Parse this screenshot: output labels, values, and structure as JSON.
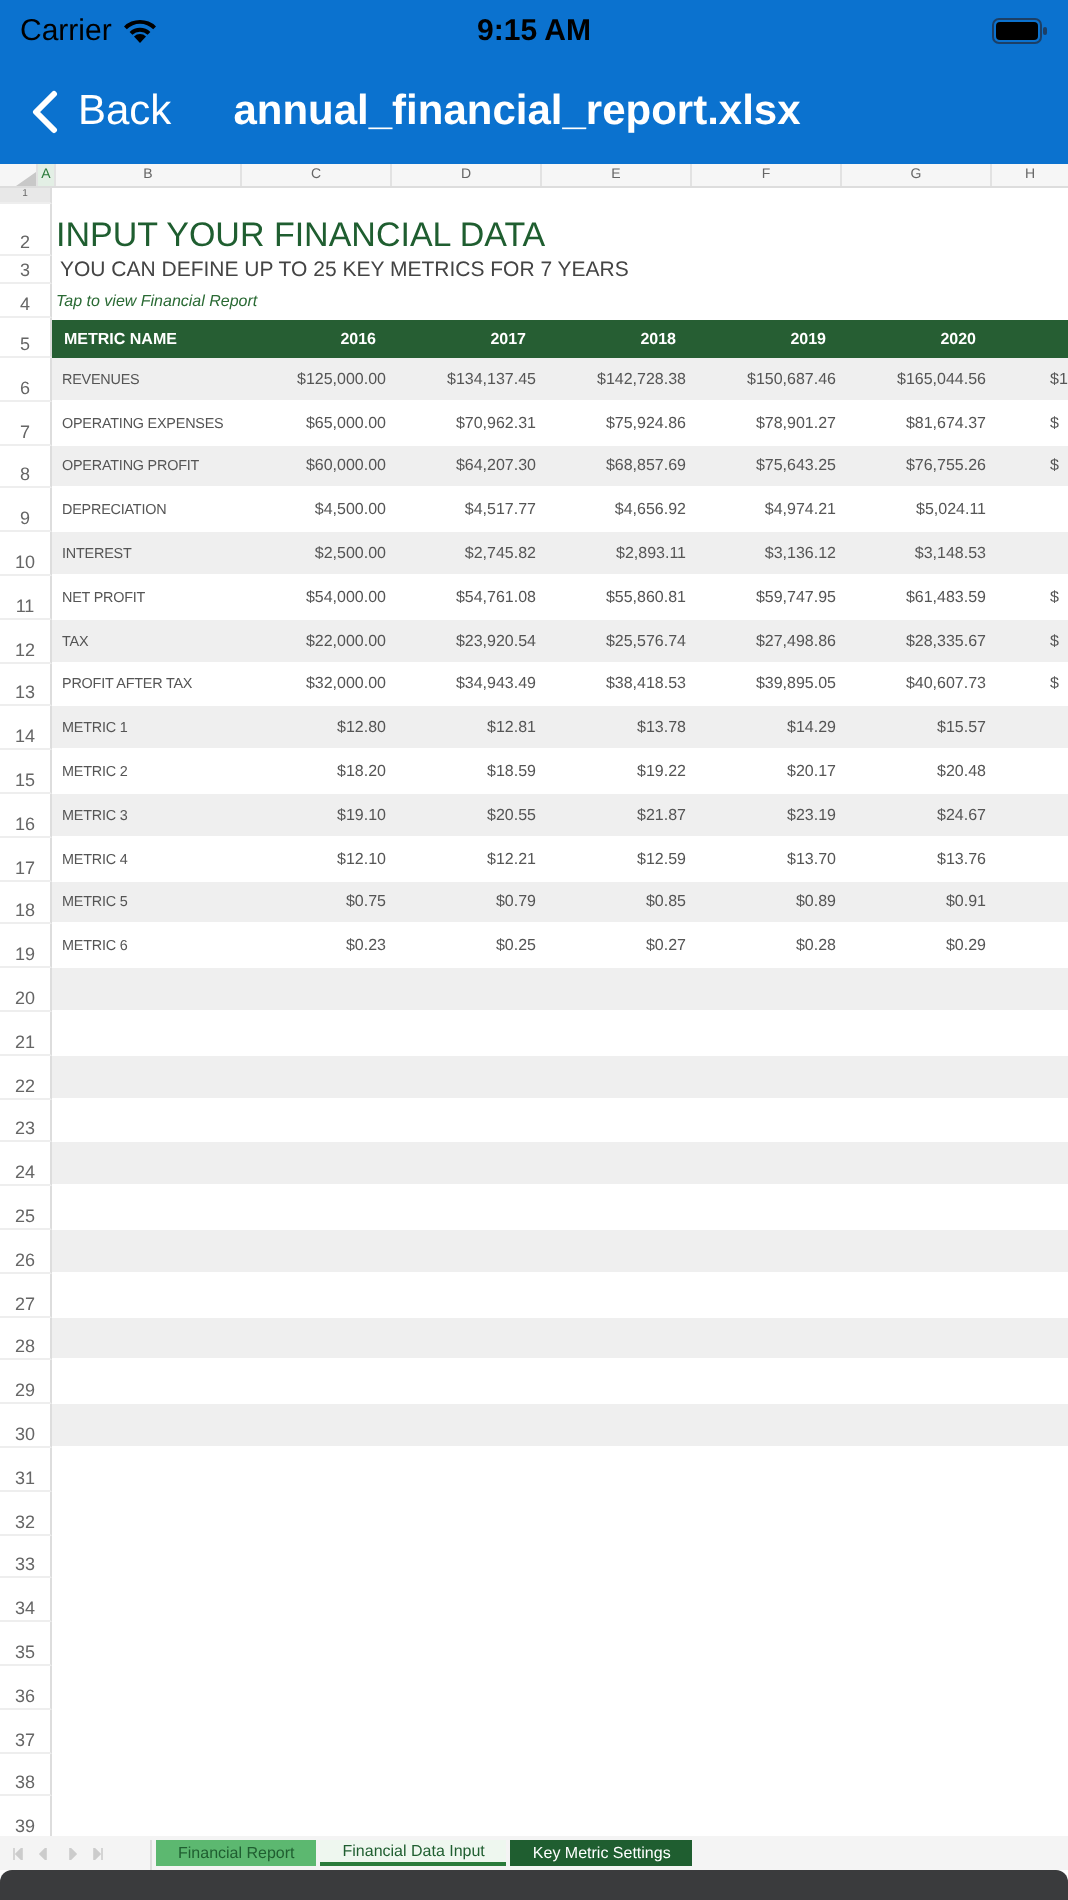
{
  "status_bar": {
    "carrier": "Carrier",
    "time": "9:15 AM"
  },
  "nav": {
    "back": "Back",
    "title": "annual_financial_report.xlsx"
  },
  "sheet": {
    "column_headers": [
      "A",
      "B",
      "C",
      "D",
      "E",
      "F",
      "G",
      "H"
    ],
    "row_numbers": [
      "1",
      "2",
      "3",
      "4",
      "5",
      "6",
      "7",
      "8",
      "9",
      "10",
      "11",
      "12",
      "13",
      "14",
      "15",
      "16",
      "17",
      "18",
      "19",
      "20",
      "21",
      "22",
      "23",
      "24",
      "25",
      "26",
      "27",
      "28",
      "29",
      "30",
      "31",
      "32",
      "33",
      "34",
      "35",
      "36",
      "37",
      "38",
      "39"
    ],
    "title": "INPUT YOUR FINANCIAL DATA",
    "subtitle": "YOU CAN DEFINE UP TO 25 KEY METRICS FOR 7 YEARS",
    "link": "Tap to view Financial Report",
    "table": {
      "columns": [
        "METRIC NAME",
        "2016",
        "2017",
        "2018",
        "2019",
        "2020"
      ],
      "rows": [
        {
          "cells": [
            "REVENUES",
            "$125,000.00",
            "$134,137.45",
            "$142,728.38",
            "$150,687.46",
            "$165,044.56"
          ],
          "column_7": "$1"
        },
        {
          "cells": [
            "OPERATING EXPENSES",
            "$65,000.00",
            "$70,962.31",
            "$75,924.86",
            "$78,901.27",
            "$81,674.37"
          ],
          "column_7": "$"
        },
        {
          "cells": [
            "OPERATING PROFIT",
            "$60,000.00",
            "$64,207.30",
            "$68,857.69",
            "$75,643.25",
            "$76,755.26"
          ],
          "column_7": "$"
        },
        {
          "cells": [
            "DEPRECIATION",
            "$4,500.00",
            "$4,517.77",
            "$4,656.92",
            "$4,974.21",
            "$5,024.11"
          ]
        },
        {
          "cells": [
            "INTEREST",
            "$2,500.00",
            "$2,745.82",
            "$2,893.11",
            "$3,136.12",
            "$3,148.53"
          ]
        },
        {
          "cells": [
            "NET PROFIT",
            "$54,000.00",
            "$54,761.08",
            "$55,860.81",
            "$59,747.95",
            "$61,483.59"
          ],
          "column_7": "$"
        },
        {
          "cells": [
            "TAX",
            "$22,000.00",
            "$23,920.54",
            "$25,576.74",
            "$27,498.86",
            "$28,335.67"
          ],
          "column_7": "$"
        },
        {
          "cells": [
            "PROFIT AFTER TAX",
            "$32,000.00",
            "$34,943.49",
            "$38,418.53",
            "$39,895.05",
            "$40,607.73"
          ],
          "column_7": "$"
        },
        {
          "cells": [
            "METRIC 1",
            "$12.80",
            "$12.81",
            "$13.78",
            "$14.29",
            "$15.57"
          ]
        },
        {
          "cells": [
            "METRIC 2",
            "$18.20",
            "$18.59",
            "$19.22",
            "$20.17",
            "$20.48"
          ]
        },
        {
          "cells": [
            "METRIC 3",
            "$19.10",
            "$20.55",
            "$21.87",
            "$23.19",
            "$24.67"
          ]
        },
        {
          "cells": [
            "METRIC 4",
            "$12.10",
            "$12.21",
            "$12.59",
            "$13.70",
            "$13.76"
          ]
        },
        {
          "cells": [
            "METRIC 5",
            "$0.75",
            "$0.79",
            "$0.85",
            "$0.89",
            "$0.91"
          ]
        },
        {
          "cells": [
            "METRIC 6",
            "$0.23",
            "$0.25",
            "$0.27",
            "$0.28",
            "$0.29"
          ]
        }
      ]
    }
  },
  "sheet_tabs": [
    {
      "label": "Financial Report",
      "selected": false,
      "color": "#5cb870"
    },
    {
      "label": "Financial Data Input",
      "selected": true,
      "color": "#eef7ef"
    },
    {
      "label": "Key Metric Settings",
      "selected": false,
      "color": "#1f5e30"
    }
  ]
}
